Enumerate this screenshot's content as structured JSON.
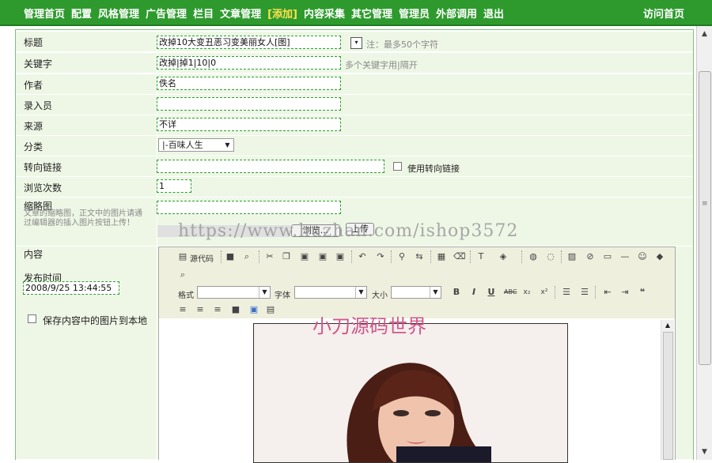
{
  "nav": {
    "items": [
      "管理首页",
      "配置",
      "风格管理",
      "广告管理",
      "栏目",
      "文章管理",
      "[添加]",
      "内容采集",
      "其它管理",
      "管理员",
      "外部调用",
      "退出"
    ],
    "highlight_index": 6,
    "visit_label": "访问首页",
    "bg_color": "#2e9a2e"
  },
  "form": {
    "title_label": "标题",
    "title_value": "改掉10大变丑恶习变美丽女人[图]",
    "title_hint": "注：最多50个字符",
    "keyword_label": "关键字",
    "keyword_value": "改掉|掉1|10|0",
    "keyword_hint": "多个关键字用|隔开",
    "author_label": "作者",
    "author_value": "佚名",
    "editor_label": "录入员",
    "editor_value": "",
    "source_label": "来源",
    "source_value": "不详",
    "category_label": "分类",
    "category_value": "|-百味人生",
    "redirect_label": "转向链接",
    "redirect_value": "",
    "redirect_check_label": "使用转向链接",
    "views_label": "浏览次数",
    "views_value": "1",
    "thumb_label": "缩略图",
    "thumb_note": "文章的缩略图，正文中的图片请通过编辑器的插入图片按钮上传！",
    "thumb_value": "",
    "browse_label": "浏览...",
    "upload_label": "上传",
    "content_label": "内容",
    "publish_label": "发布时间",
    "publish_value": "2008/9/25 13:44:55",
    "save_images_label": "保存内容中的图片到本地"
  },
  "watermark": "https://www.huzhan.com/ishop3572",
  "toolbar": {
    "source_code_label": "源代码",
    "format_label": "格式",
    "font_label": "字体",
    "size_label": "大小"
  },
  "content_image_text": "小刀源码世界"
}
